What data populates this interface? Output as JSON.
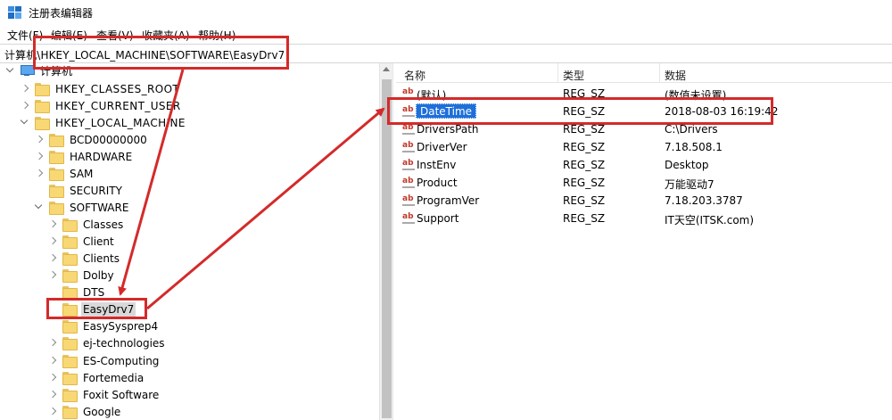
{
  "window": {
    "title": "注册表编辑器"
  },
  "menu": [
    "文件(F)",
    "编辑(E)",
    "查看(V)",
    "收藏夹(A)",
    "帮助(H)"
  ],
  "address": "计算机\\HKEY_LOCAL_MACHINE\\SOFTWARE\\EasyDrv7",
  "tree": {
    "root": "计算机",
    "items": [
      {
        "label": "HKEY_CLASSES_ROOT",
        "expander": "right"
      },
      {
        "label": "HKEY_CURRENT_USER",
        "expander": "right"
      },
      {
        "label": "HKEY_LOCAL_MACHINE",
        "expander": "down"
      },
      {
        "label": "BCD00000000",
        "expander": "right"
      },
      {
        "label": "HARDWARE",
        "expander": "right"
      },
      {
        "label": "SAM",
        "expander": "right"
      },
      {
        "label": "SECURITY",
        "expander": "none"
      },
      {
        "label": "SOFTWARE",
        "expander": "down"
      },
      {
        "label": "Classes",
        "expander": "right"
      },
      {
        "label": "Client",
        "expander": "right"
      },
      {
        "label": "Clients",
        "expander": "right"
      },
      {
        "label": "Dolby",
        "expander": "right"
      },
      {
        "label": "DTS",
        "expander": "none"
      },
      {
        "label": "EasyDrv7",
        "expander": "none",
        "selected": true
      },
      {
        "label": "EasySysprep4",
        "expander": "none"
      },
      {
        "label": "ej-technologies",
        "expander": "right"
      },
      {
        "label": "ES-Computing",
        "expander": "right"
      },
      {
        "label": "Fortemedia",
        "expander": "right"
      },
      {
        "label": "Foxit Software",
        "expander": "right"
      },
      {
        "label": "Google",
        "expander": "right"
      }
    ]
  },
  "list": {
    "columns": {
      "name": "名称",
      "type": "类型",
      "data": "数据"
    },
    "icon": "ab",
    "rows": [
      {
        "name": "(默认)",
        "type": "REG_SZ",
        "data": "(数值未设置)"
      },
      {
        "name": "DateTime",
        "type": "REG_SZ",
        "data": "2018-08-03 16:19:42",
        "selected": true
      },
      {
        "name": "DriversPath",
        "type": "REG_SZ",
        "data": "C:\\Drivers"
      },
      {
        "name": "DriverVer",
        "type": "REG_SZ",
        "data": "7.18.508.1"
      },
      {
        "name": "InstEnv",
        "type": "REG_SZ",
        "data": "Desktop"
      },
      {
        "name": "Product",
        "type": "REG_SZ",
        "data": "万能驱动7"
      },
      {
        "name": "ProgramVer",
        "type": "REG_SZ",
        "data": "7.18.203.3787"
      },
      {
        "name": "Support",
        "type": "REG_SZ",
        "data": "IT天空(ITSK.com)"
      }
    ]
  },
  "colors": {
    "annotation": "#d42a2a",
    "selection": "#1e6fd9",
    "folder": "#f8d775"
  }
}
